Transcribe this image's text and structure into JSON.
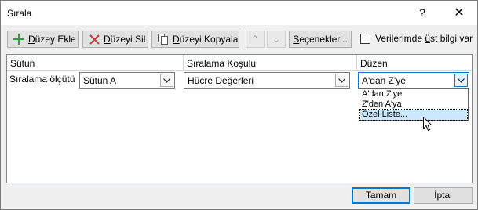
{
  "window": {
    "title": "Sırala",
    "help_glyph": "?",
    "close_glyph": "✕"
  },
  "toolbar": {
    "add_level": {
      "prefix": "",
      "mnemonic": "D",
      "rest": "üzey Ekle"
    },
    "delete_level": {
      "prefix": "",
      "mnemonic": "D",
      "rest": "üzeyi Sil"
    },
    "copy_level": {
      "prefix": "",
      "mnemonic": "D",
      "rest": "üzeyi Kopyala"
    },
    "move_up_glyph": "⌃",
    "move_down_glyph": "⌄",
    "options": {
      "prefix": "",
      "mnemonic": "S",
      "rest": "eçenekler..."
    },
    "headers_checkbox": {
      "prefix": "Verilerimde ",
      "mnemonic": "ü",
      "rest": "st bilgi var",
      "checked": false
    }
  },
  "grid": {
    "headers": {
      "column": "Sütun",
      "sort_on": "Sıralama Koşulu",
      "order": "Düzen"
    },
    "rows": [
      {
        "label": "Sıralama ölçütü",
        "column_value": "Sütun A",
        "sort_on_value": "Hücre Değerleri",
        "order_value": "A'dan Z'ye"
      }
    ]
  },
  "order_dropdown": {
    "options": [
      "A'dan Z'ye",
      "Z'den A'ya",
      "Özel Liste..."
    ],
    "highlighted_index": 2
  },
  "footer": {
    "ok_label": "Tamam",
    "cancel_label": "İptal"
  },
  "colors": {
    "accent": "#0078d7",
    "highlight": "#cce8ff",
    "add_icon": "#2e9e3a",
    "delete_icon": "#d9363e"
  }
}
